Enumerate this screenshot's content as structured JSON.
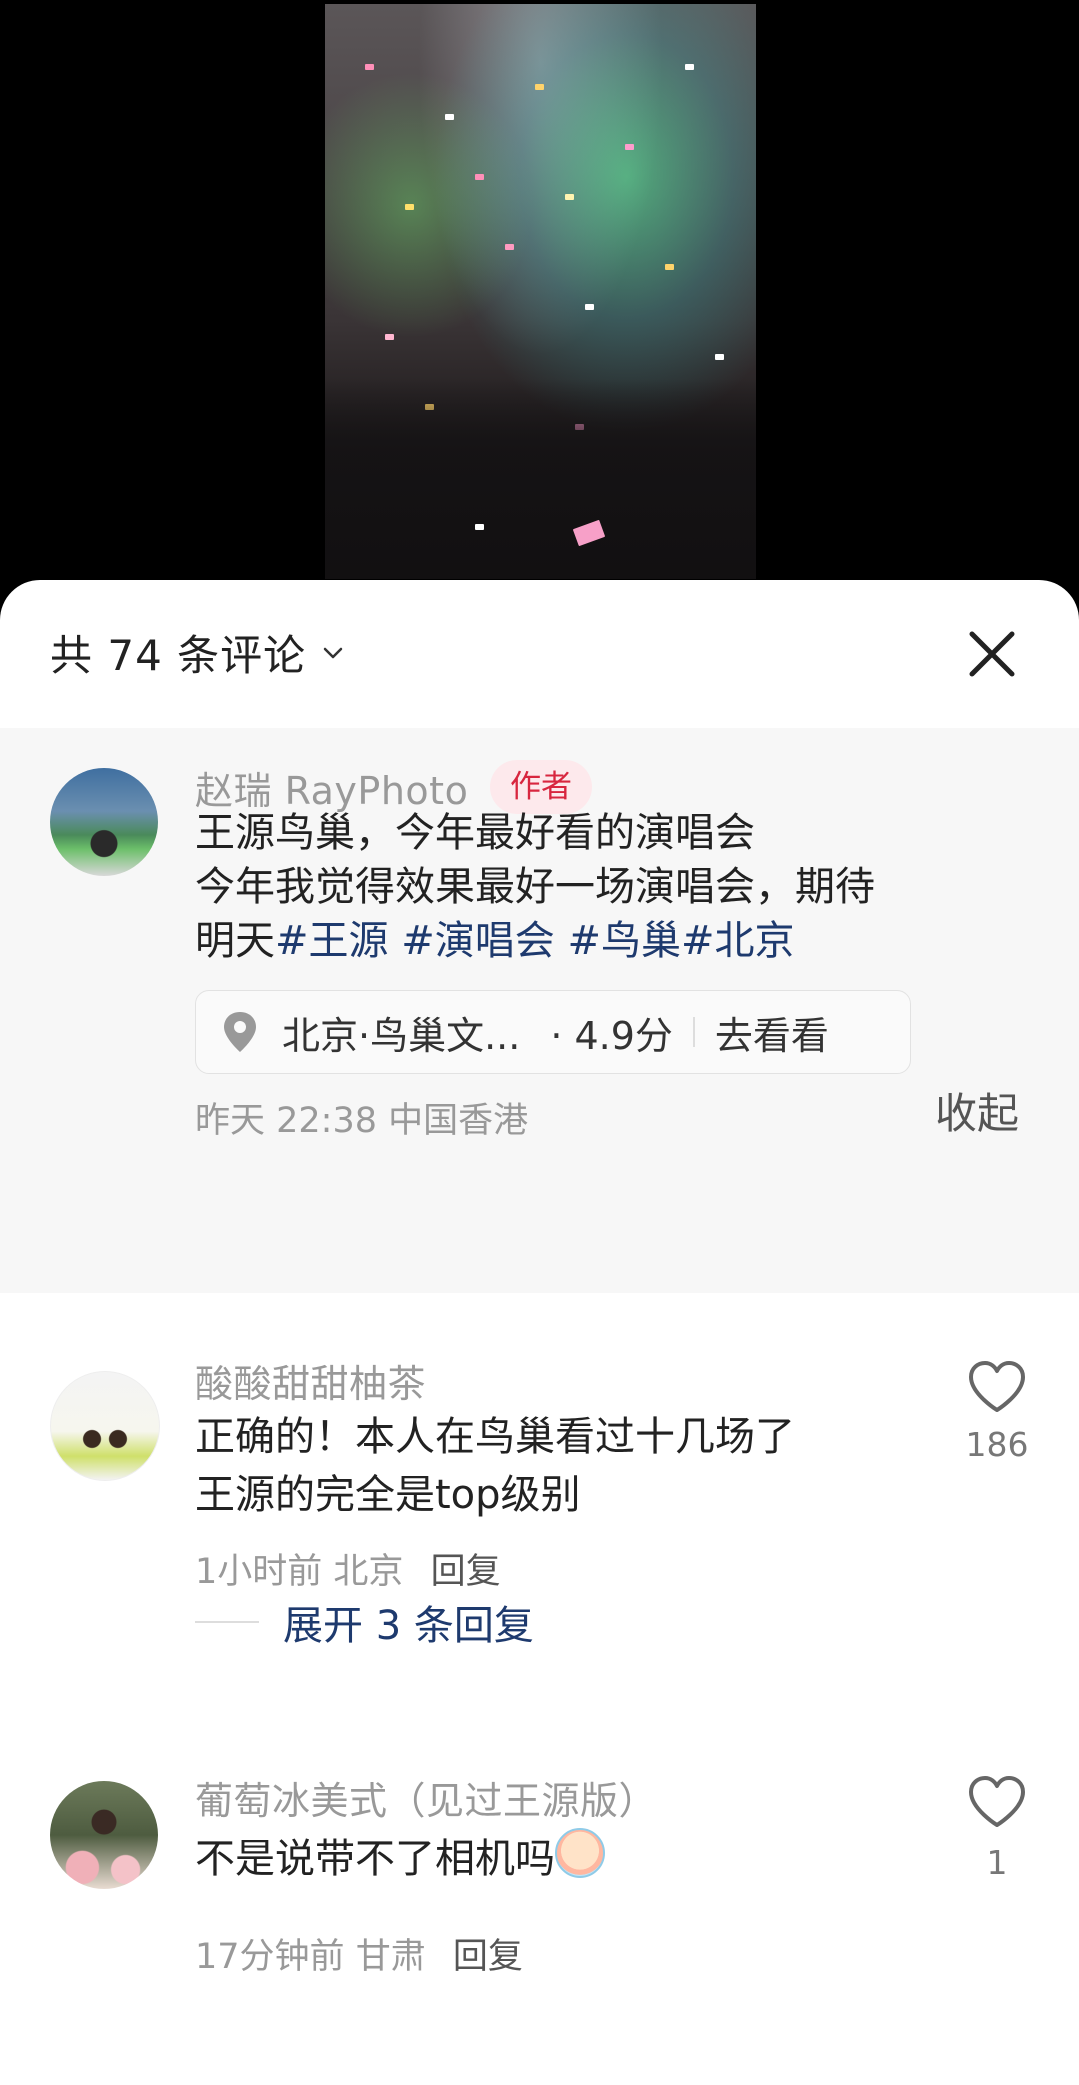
{
  "header": {
    "count_title": "共 74 条评论"
  },
  "author_post": {
    "username": "赵瑞 RayPhoto",
    "badge": "作者",
    "text_line1": "王源鸟巢，今年最好看的演唱会",
    "text_line2": "今年我觉得效果最好一场演唱会，期待",
    "text_line3_prefix": "明天",
    "hashtags": [
      "#王源",
      "#演唱会",
      "#鸟巢",
      "#北京"
    ],
    "location": {
      "name": "北京·鸟巢文...",
      "rating": "· 4.9分",
      "action": "去看看"
    },
    "time": "昨天 22:38",
    "region": "中国香港",
    "collapse_label": "收起"
  },
  "comments": [
    {
      "username": "酸酸甜甜柚茶",
      "line1": "正确的！本人在鸟巢看过十几场了",
      "line2": "王源的完全是top级别",
      "time": "1小时前",
      "region": "北京",
      "reply_label": "回复",
      "likes": "186",
      "expand_label": "展开 3 条回复"
    },
    {
      "username": "葡萄冰美式（见过王源版）",
      "line1": "不是说带不了相机吗",
      "time": "17分钟前",
      "region": "甘肃",
      "reply_label": "回复",
      "likes": "1"
    }
  ]
}
